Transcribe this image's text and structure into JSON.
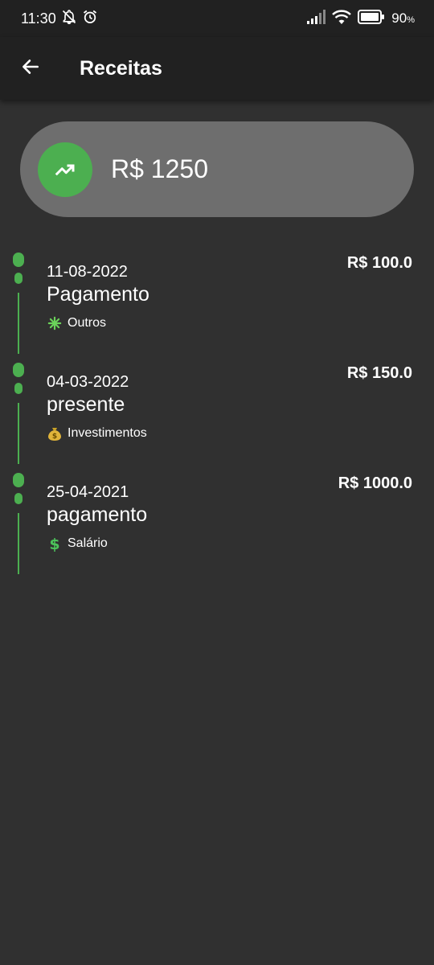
{
  "status_bar": {
    "time": "11:30",
    "battery_percent": "90",
    "battery_unit": "%"
  },
  "app_bar": {
    "title": "Receitas",
    "back_icon": "arrow-back-icon"
  },
  "summary": {
    "icon": "trending-up-icon",
    "total": "R$ 1250"
  },
  "entries": [
    {
      "date": "11-08-2022",
      "description": "Pagamento",
      "category": "Outros",
      "category_icon": "sparkle-icon",
      "amount": "R$ 100.0"
    },
    {
      "date": "04-03-2022",
      "description": "presente",
      "category": "Investimentos",
      "category_icon": "money-bag-icon",
      "amount": "R$ 150.0"
    },
    {
      "date": "25-04-2021",
      "description": "pagamento",
      "category": "Salário",
      "category_icon": "dollar-sign-icon",
      "amount": "R$ 1000.0"
    }
  ],
  "colors": {
    "accent": "#4caf50",
    "background": "#303030",
    "app_bar": "#212121",
    "summary_pill": "#6e6e6e"
  }
}
